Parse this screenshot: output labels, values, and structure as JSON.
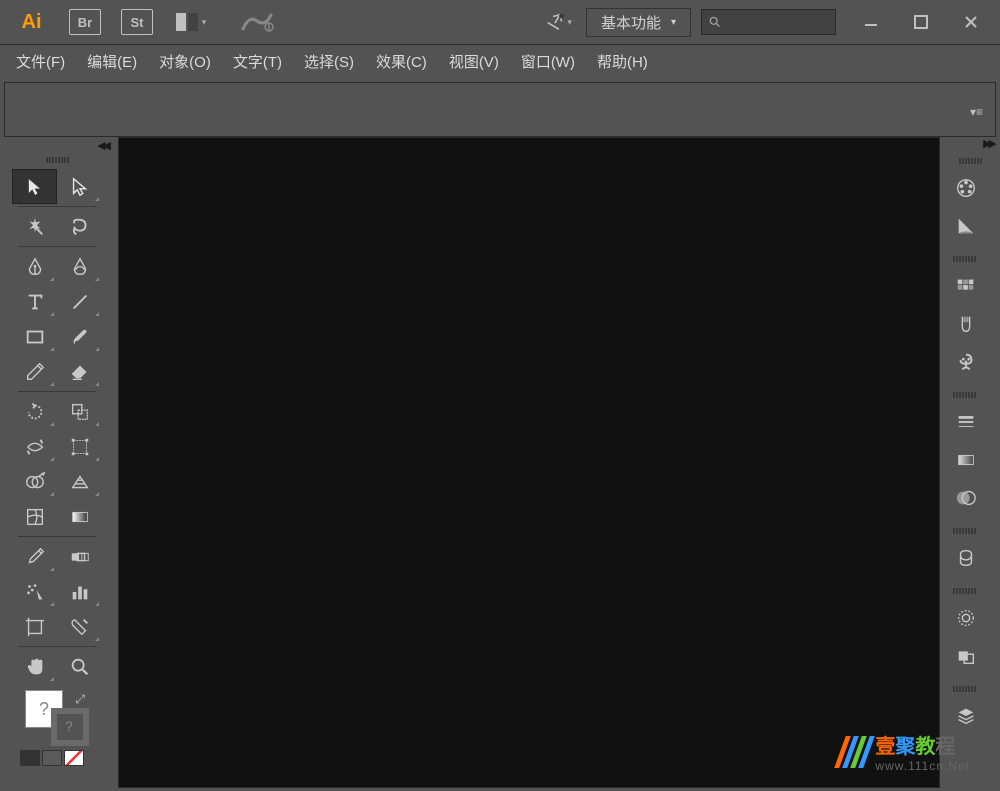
{
  "titlebar": {
    "logo": "Ai",
    "badges": [
      "Br",
      "St"
    ],
    "workspace_label": "基本功能",
    "search_placeholder": ""
  },
  "menubar": {
    "items": [
      "文件(F)",
      "编辑(E)",
      "对象(O)",
      "文字(T)",
      "选择(S)",
      "效果(C)",
      "视图(V)",
      "窗口(W)",
      "帮助(H)"
    ]
  },
  "tools": {
    "items": [
      {
        "name": "selection-tool",
        "active": true,
        "tri": false
      },
      {
        "name": "direct-selection-tool",
        "active": false,
        "tri": true
      },
      {
        "name": "magic-wand-tool",
        "active": false,
        "tri": false
      },
      {
        "name": "lasso-tool",
        "active": false,
        "tri": false
      },
      {
        "name": "pen-tool",
        "active": false,
        "tri": true
      },
      {
        "name": "curvature-tool",
        "active": false,
        "tri": true
      },
      {
        "name": "type-tool",
        "active": false,
        "tri": true
      },
      {
        "name": "line-segment-tool",
        "active": false,
        "tri": true
      },
      {
        "name": "rectangle-tool",
        "active": false,
        "tri": true
      },
      {
        "name": "paintbrush-tool",
        "active": false,
        "tri": true
      },
      {
        "name": "pencil-tool",
        "active": false,
        "tri": true
      },
      {
        "name": "eraser-tool",
        "active": false,
        "tri": true
      },
      {
        "name": "rotate-tool",
        "active": false,
        "tri": true
      },
      {
        "name": "scale-tool",
        "active": false,
        "tri": true
      },
      {
        "name": "width-tool",
        "active": false,
        "tri": true
      },
      {
        "name": "free-transform-tool",
        "active": false,
        "tri": true
      },
      {
        "name": "shape-builder-tool",
        "active": false,
        "tri": true
      },
      {
        "name": "perspective-grid-tool",
        "active": false,
        "tri": true
      },
      {
        "name": "mesh-tool",
        "active": false,
        "tri": false
      },
      {
        "name": "gradient-tool",
        "active": false,
        "tri": false
      },
      {
        "name": "eyedropper-tool",
        "active": false,
        "tri": true
      },
      {
        "name": "blend-tool",
        "active": false,
        "tri": false
      },
      {
        "name": "symbol-sprayer-tool",
        "active": false,
        "tri": true
      },
      {
        "name": "column-graph-tool",
        "active": false,
        "tri": true
      },
      {
        "name": "artboard-tool",
        "active": false,
        "tri": false
      },
      {
        "name": "slice-tool",
        "active": false,
        "tri": true
      },
      {
        "name": "hand-tool",
        "active": false,
        "tri": true
      },
      {
        "name": "zoom-tool",
        "active": false,
        "tri": false
      }
    ],
    "fill_placeholder": "?",
    "bottom_colors": [
      "#333333",
      "#5a5a5a",
      "#ff3030"
    ]
  },
  "right_panels": [
    {
      "name": "color-panel"
    },
    {
      "name": "color-guide-panel"
    },
    {
      "name": "swatches-panel"
    },
    {
      "name": "brushes-panel"
    },
    {
      "name": "symbols-panel"
    },
    {
      "name": "stroke-panel"
    },
    {
      "name": "gradient-panel"
    },
    {
      "name": "transparency-panel"
    },
    {
      "name": "libraries-panel"
    },
    {
      "name": "appearance-panel"
    },
    {
      "name": "graphic-styles-panel"
    },
    {
      "name": "layers-panel"
    }
  ],
  "watermark": {
    "title_chars": [
      {
        "t": "壹",
        "c": "#ff6600"
      },
      {
        "t": "聚",
        "c": "#3399ff"
      },
      {
        "t": "教",
        "c": "#66cc33"
      },
      {
        "t": "程",
        "c": "#666666"
      }
    ],
    "url": "www.111cn.Net",
    "stripe_colors": [
      "#ff6600",
      "#3399ff",
      "#66cc33",
      "#3399ff"
    ]
  }
}
